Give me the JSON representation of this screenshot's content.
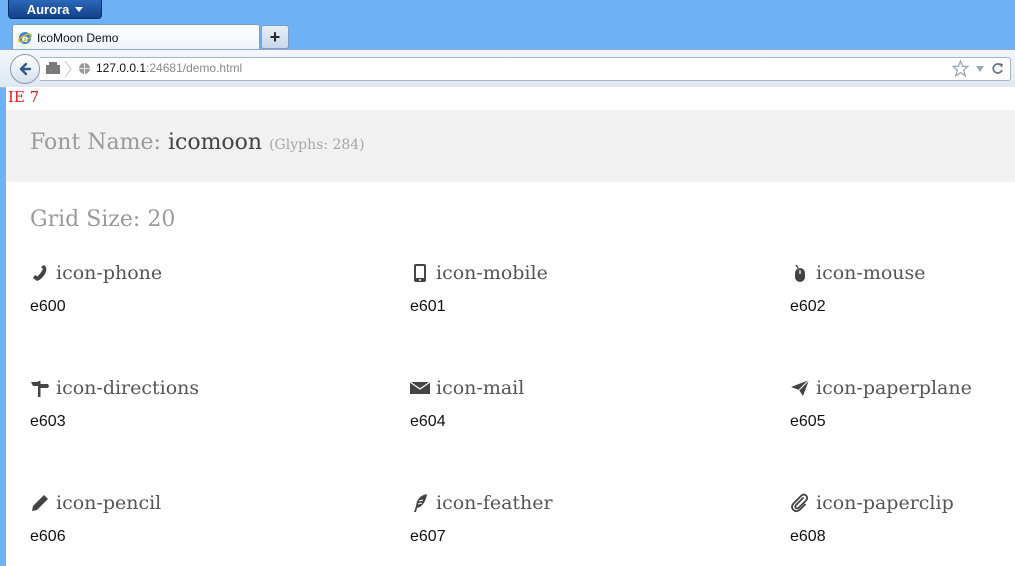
{
  "browser": {
    "app_button": "Aurora",
    "tab_title": "IcoMoon Demo",
    "new_tab": "+",
    "url_host": "127.0.0.1",
    "url_rest": ":24681/demo.html"
  },
  "page": {
    "ie_label": "IE 7",
    "font_label": "Font Name:",
    "font_name": "icomoon",
    "glyphs_note": "(Glyphs: 284)",
    "grid_size": "Grid Size: 20"
  },
  "glyphs": [
    {
      "name": "icon-phone",
      "code": "e600",
      "icon": "phone-icon"
    },
    {
      "name": "icon-mobile",
      "code": "e601",
      "icon": "mobile-icon"
    },
    {
      "name": "icon-mouse",
      "code": "e602",
      "icon": "mouse-icon"
    },
    {
      "name": "icon-directions",
      "code": "e603",
      "icon": "directions-icon"
    },
    {
      "name": "icon-mail",
      "code": "e604",
      "icon": "mail-icon"
    },
    {
      "name": "icon-paperplane",
      "code": "e605",
      "icon": "paperplane-icon"
    },
    {
      "name": "icon-pencil",
      "code": "e606",
      "icon": "pencil-icon"
    },
    {
      "name": "icon-feather",
      "code": "e607",
      "icon": "feather-icon"
    },
    {
      "name": "icon-paperclip",
      "code": "e608",
      "icon": "paperclip-icon"
    }
  ]
}
